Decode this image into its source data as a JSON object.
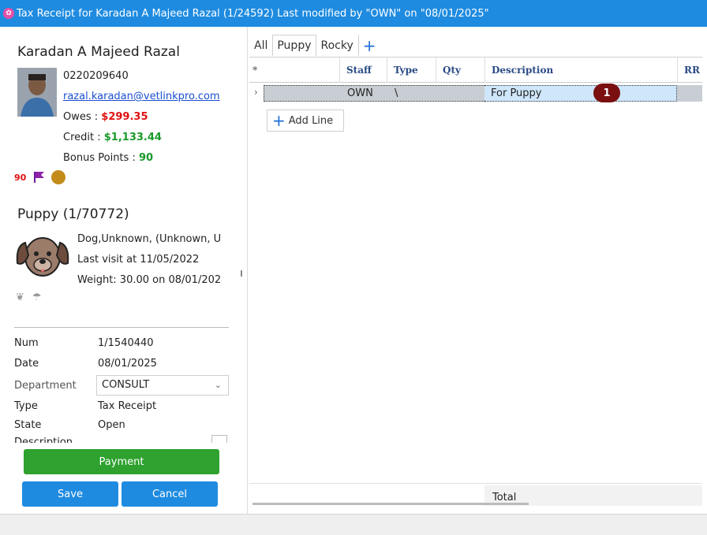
{
  "window": {
    "title": "Tax Receipt for Karadan A Majeed Razal (1/24592) Last modified by \"OWN\" on \"08/01/2025\""
  },
  "owner": {
    "name": "Karadan A Majeed Razal",
    "phone": "0220209640",
    "email": "razal.karadan@vetlinkpro.com",
    "owes_label": "Owes : ",
    "owes_value": "$299.35",
    "credit_label": "Credit : ",
    "credit_value": "$1,133.44",
    "bonus_label": "Bonus Points : ",
    "bonus_value": "90",
    "flag_number": "90"
  },
  "pet": {
    "name": "Puppy (1/70772)",
    "line1": "Dog,Unknown, (Unknown, U",
    "line2": "Last visit at 11/05/2022",
    "line3": "Weight: 30.00 on 08/01/202"
  },
  "fields": {
    "num_label": "Num",
    "num_value": "1/1540440",
    "date_label": "Date",
    "date_value": "08/01/2025",
    "department_label": "Department",
    "department_value": "CONSULT",
    "type_label": "Type",
    "type_value": "Tax Receipt",
    "state_label": "State",
    "state_value": "Open",
    "description_label": "Description"
  },
  "buttons": {
    "payment": "Payment",
    "save": "Save",
    "cancel": "Cancel"
  },
  "tabs": [
    "All",
    "Puppy",
    "Rocky",
    "+"
  ],
  "grid": {
    "columns": [
      "*",
      "Staff",
      "Type",
      "Qty",
      "Description",
      "RR"
    ],
    "rows": [
      {
        "staff": "OWN",
        "type": "\\",
        "qty": "",
        "description": "For Puppy"
      }
    ],
    "badge": "1",
    "add_line": "Add Line",
    "total_label": "Total"
  }
}
